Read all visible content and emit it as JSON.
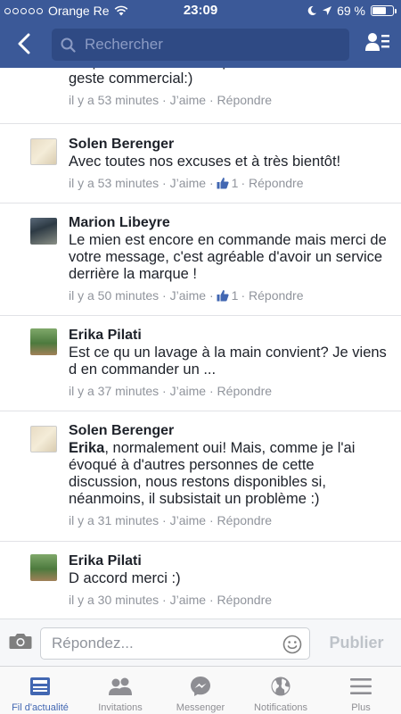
{
  "status_bar": {
    "carrier": "Orange Re",
    "time": "23:09",
    "battery": "69 %",
    "battery_level": 0.69
  },
  "nav": {
    "search_placeholder": "Rechercher"
  },
  "comments": [
    {
      "text": "téléphoner s'ne n'osiez pour bénéficier d'un geste commercial:)",
      "time": "il y a 53 minutes",
      "like_label": "J’aime",
      "reply_label": "Répondre"
    },
    {
      "name": "Solen Berenger",
      "text": "Avec toutes nos excuses et à très bientôt!",
      "time": "il y a 53 minutes",
      "like_label": "J’aime",
      "like_count": "1",
      "reply_label": "Répondre"
    },
    {
      "name": "Marion Libeyre",
      "text": "Le mien est encore en commande mais merci de votre message, c'est agréable d'avoir un service derrière la marque !",
      "time": "il y a 50 minutes",
      "like_label": "J’aime",
      "like_count": "1",
      "reply_label": "Répondre"
    },
    {
      "name": "Erika Pilati",
      "text": "Est ce qu un lavage à la main convient?  Je viens d en commander un ...",
      "time": "il y a 37 minutes",
      "like_label": "J’aime",
      "reply_label": "Répondre"
    },
    {
      "name": "Solen Berenger",
      "mention": "Erika",
      "text": ", normalement oui! Mais, comme je l'ai évoqué à d'autres personnes de cette discussion, nous restons disponibles si, néanmoins, il subsistait un problème :)",
      "time": "il y a 31 minutes",
      "like_label": "J’aime",
      "reply_label": "Répondre"
    },
    {
      "name": "Erika Pilati",
      "text": "D accord merci :)",
      "time": "il y a 30 minutes",
      "like_label": "J’aime",
      "reply_label": "Répondre"
    }
  ],
  "composer": {
    "placeholder": "Répondez...",
    "publish_label": "Publier"
  },
  "tabbar": {
    "tabs": [
      {
        "label": "Fil d'actualité",
        "icon": "news-feed-icon",
        "active": true
      },
      {
        "label": "Invitations",
        "icon": "friends-icon"
      },
      {
        "label": "Messenger",
        "icon": "messenger-icon"
      },
      {
        "label": "Notifications",
        "icon": "globe-icon"
      },
      {
        "label": "Plus",
        "icon": "menu-icon"
      }
    ]
  },
  "colors": {
    "brand": "#3b5998",
    "active_tab": "#4267b2",
    "meta_text": "#90949c"
  }
}
